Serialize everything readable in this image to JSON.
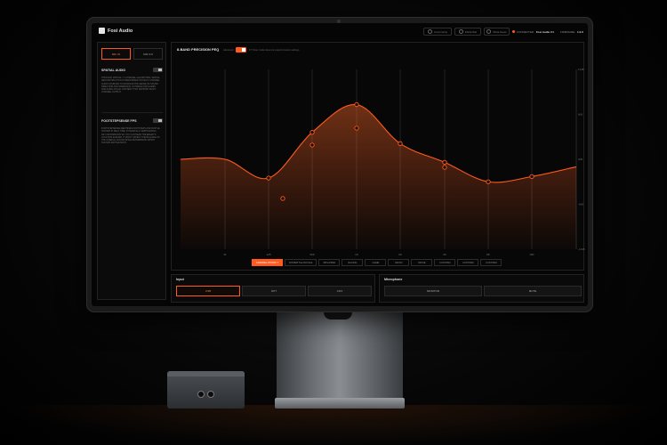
{
  "app": {
    "brand": "Fosi Audio",
    "toolbar": [
      {
        "label": "Community",
        "icon": "community-icon"
      },
      {
        "label": "ENGLISH",
        "icon": "globe-icon"
      },
      {
        "label": "What News",
        "icon": "news-icon"
      }
    ],
    "connection": {
      "label": "CONNECTED:",
      "device": "Fosi Audio C1",
      "firmware_label": "FIRMWARE:",
      "firmware": "1.2.0"
    }
  },
  "sidebar": {
    "tabs": [
      {
        "label": "MIC IN",
        "active": true
      },
      {
        "label": "MIC 3.5",
        "active": false
      }
    ],
    "features": [
      {
        "title": "SPATIAL AUDIO",
        "enabled": false,
        "description": "THROUGH VIRTUAL 7.1 CHANNEL ALGORITHMS, SPATIAL RECONSTRUCTION IS PERFORMED ON MULTI-CHANNEL AUDIO SOURCES TO ENHANCE THE SENSE OF SOUND DIRECTION AND IMMERSION, SUITABLE FOR GAMES AND AUDIO-VISUAL CONTENT THAT SUPPORT MULTI-CHANNEL OUTPUT."
      },
      {
        "title": "FOOTSTEPSENSE FPS",
        "enabled": false,
        "description": "FOOTSTEPSENSE IDENTIFIES FOOTSTEPS AND RUSTLE SOUNDS IN REAL TIME, DYNAMICALLY EMPHASIZING KEY INFORMATION SO YOU CAN HEAR THE ENEMY'S LOCATION EARLIER. IT WON'T AFFECT THE BALANCE OF THE OVERALL SOUND WHILE DETERMINING WHICH SOUNDS MATTER MOST."
      }
    ]
  },
  "eq": {
    "title": "8-BAND PRECISION PEQ",
    "toggle_label": "Advanced",
    "enabled": true,
    "note": "F7 Tuner mode does not support custom settings",
    "accent": "#ff5a1f",
    "freq_labels": [
      "31",
      "125",
      "500",
      "1K",
      "2K",
      "4K",
      "8K",
      "16K"
    ],
    "gain_labels": [
      "12dB",
      "6dB",
      "0dB",
      "-6dB",
      "-12dB"
    ],
    "bands": [
      {
        "freq": "31",
        "gain_db": 0.0
      },
      {
        "freq": "125",
        "gain_db": -2.5
      },
      {
        "freq": "500",
        "gain_db": 3.6
      },
      {
        "freq": "1K",
        "gain_db": 7.3
      },
      {
        "freq": "2K",
        "gain_db": 2.1
      },
      {
        "freq": "4K",
        "gain_db": -0.4
      },
      {
        "freq": "8K",
        "gain_db": -3.0
      },
      {
        "freq": "16K",
        "gain_db": -2.3
      }
    ],
    "presets": [
      {
        "label": "CHANNEL STUDIO 7",
        "active": true
      },
      {
        "label": "FPS/BATTLE ROYALE",
        "active": false
      },
      {
        "label": "RPG/OPEN",
        "active": false
      },
      {
        "label": "RACING",
        "active": false
      },
      {
        "label": "GAME",
        "active": false
      },
      {
        "label": "MUSIC",
        "active": false
      },
      {
        "label": "MOVIE",
        "active": false
      },
      {
        "label": "CUSTOM1",
        "active": false
      },
      {
        "label": "CUSTOM2",
        "active": false
      },
      {
        "label": "CUSTOM3",
        "active": false
      }
    ]
  },
  "input": {
    "title": "Input",
    "options": [
      {
        "label": "USB",
        "active": true
      },
      {
        "label": "OPT",
        "active": false
      },
      {
        "label": "COX",
        "active": false
      }
    ]
  },
  "microphone": {
    "title": "Microphone",
    "options": [
      {
        "label": "MONITOR",
        "active": false
      },
      {
        "label": "MUTE",
        "active": false
      }
    ]
  }
}
